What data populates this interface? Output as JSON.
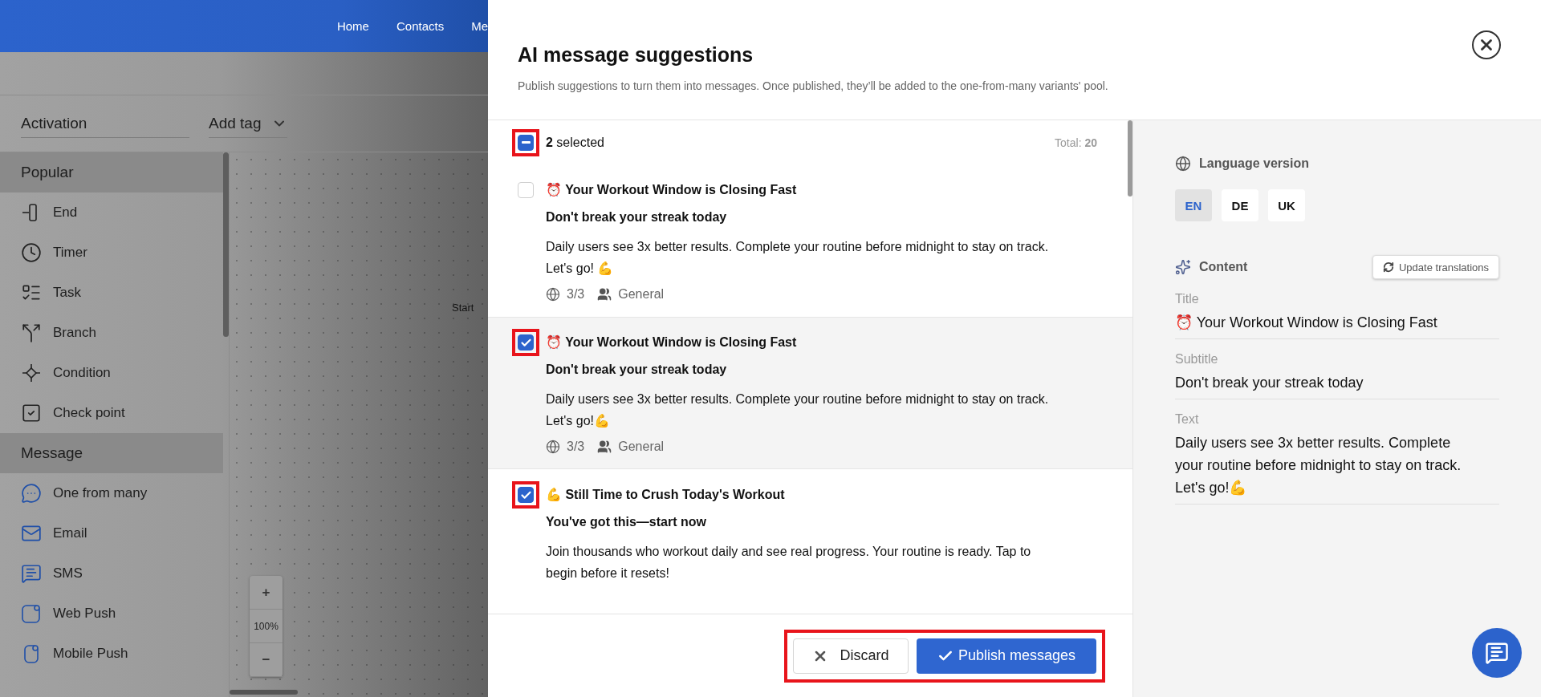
{
  "nav": {
    "items": [
      "Home",
      "Contacts",
      "Me"
    ]
  },
  "flow_toolbar": {
    "name_field": "Activation",
    "tag_dropdown": "Add tag"
  },
  "palette": {
    "sections": [
      {
        "title": "Popular",
        "items": [
          {
            "label": "End",
            "kind": "end"
          },
          {
            "label": "Timer",
            "kind": "timer"
          },
          {
            "label": "Task",
            "kind": "task"
          },
          {
            "label": "Branch",
            "kind": "branch"
          },
          {
            "label": "Condition",
            "kind": "condition"
          },
          {
            "label": "Check point",
            "kind": "checkpoint"
          }
        ]
      },
      {
        "title": "Message",
        "items": [
          {
            "label": "One from many",
            "kind": "onefrommany"
          },
          {
            "label": "Email",
            "kind": "email"
          },
          {
            "label": "SMS",
            "kind": "sms"
          },
          {
            "label": "Web Push",
            "kind": "webpush"
          },
          {
            "label": "Mobile Push",
            "kind": "mobilepush"
          }
        ]
      }
    ]
  },
  "canvas": {
    "node_label": "Start",
    "zoom_in": "+",
    "zoom_level": "100%",
    "zoom_out": "−"
  },
  "dialog": {
    "title": "AI message suggestions",
    "subtitle": "Publish suggestions to turn them into messages. Once published, they’ll be added to the one-from-many variants' pool.",
    "select_all": {
      "indeterminate": true,
      "annotated": true,
      "label": "**2** selected"
    },
    "total": "Total: **20**",
    "suggestions": [
      {
        "checked": false,
        "annotated": false,
        "hovered": false,
        "title": "⏰ Your Workout Window is Closing Fast",
        "subtitle": "Don't break your streak today",
        "text": "Daily users see 3x better results. Complete your routine before midnight to stay on track. Let's go! 💪",
        "languages": "3/3",
        "audience": "General"
      },
      {
        "checked": true,
        "annotated": true,
        "hovered": true,
        "title": "⏰ Your Workout Window is Closing Fast",
        "subtitle": "Don't break your streak today",
        "text": "Daily users see 3x better results. Complete your routine before midnight to stay on track. Let's go!💪",
        "languages": "3/3",
        "audience": "General"
      },
      {
        "checked": true,
        "annotated": true,
        "hovered": false,
        "title": "💪 Still Time to Crush Today's Workout",
        "subtitle": "You've got this—start now",
        "text": "Join thousands who workout daily and see real progress. Your routine is ready. Tap to begin before it resets!"
      }
    ],
    "footer": {
      "annotated": true,
      "discard": "Discard",
      "publish": "Publish messages"
    },
    "details": {
      "language_heading": "Language version",
      "languages": [
        {
          "label": "EN",
          "selected": true
        },
        {
          "label": "DE",
          "selected": false
        },
        {
          "label": "UK",
          "selected": false
        }
      ],
      "content_heading": "Content",
      "update_button": "Update translations",
      "fields": [
        {
          "label": "Title",
          "value": "⏰ Your Workout Window is Closing Fast"
        },
        {
          "label": "Subtitle",
          "value": "Don't break your streak today"
        },
        {
          "label": "Text",
          "value": "Daily users see 3x better results. Complete your routine before midnight to stay on track. Let's go!💪"
        }
      ]
    }
  }
}
